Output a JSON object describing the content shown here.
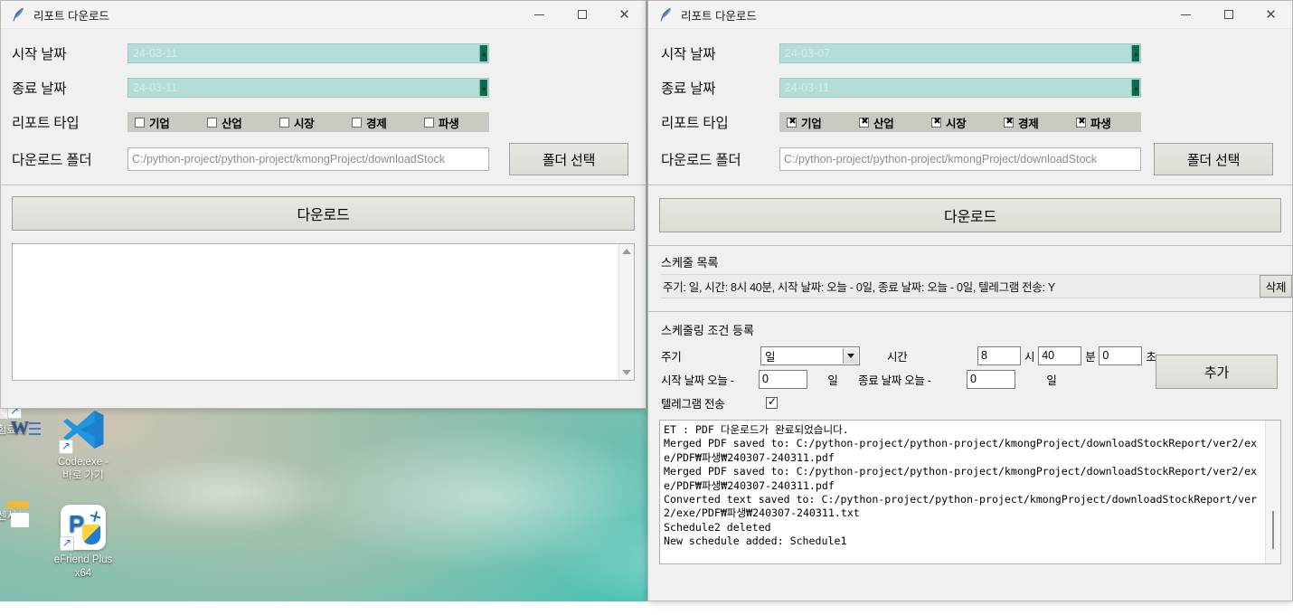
{
  "desktop": {
    "icons": [
      {
        "name": "word-doc-shortcut",
        "label": "보험료…",
        "type": "document"
      },
      {
        "name": "vscode-shortcut",
        "label": "Code.exe -\n바로 가기",
        "type": "vscode"
      },
      {
        "name": "folder-shortcut",
        "label": "견센서…",
        "type": "folder"
      },
      {
        "name": "efriend-plus-shortcut",
        "label": "eFriend Plus\nx64",
        "type": "app"
      }
    ]
  },
  "window_left": {
    "title": "리포트 다운로드",
    "titlebar": {
      "minimize": "–",
      "maximize": "□",
      "close": "✕"
    },
    "form": {
      "start_date_label": "시작 날짜",
      "start_date_value": "24-03-11",
      "end_date_label": "종료 날짜",
      "end_date_value": "24-03-11",
      "report_type_label": "리포트 타입",
      "report_types": [
        {
          "label": "기업",
          "checked": false
        },
        {
          "label": "산업",
          "checked": false
        },
        {
          "label": "시장",
          "checked": false
        },
        {
          "label": "경제",
          "checked": false
        },
        {
          "label": "파생",
          "checked": false
        }
      ],
      "folder_label": "다운로드 폴더",
      "folder_value": "C:/python-project/python-project/kmongProject/downloadStock",
      "folder_button": "폴더 선택"
    },
    "download_button": "다운로드",
    "log_text": ""
  },
  "window_right": {
    "title": "리포트 다운로드",
    "titlebar": {
      "minimize": "–",
      "maximize": "□",
      "close": "✕"
    },
    "form": {
      "start_date_label": "시작 날짜",
      "start_date_value": "24-03-07",
      "end_date_label": "종료 날짜",
      "end_date_value": "24-03-11",
      "report_type_label": "리포트 타입",
      "report_types": [
        {
          "label": "기업",
          "checked": true
        },
        {
          "label": "산업",
          "checked": true
        },
        {
          "label": "시장",
          "checked": true
        },
        {
          "label": "경제",
          "checked": true
        },
        {
          "label": "파생",
          "checked": true
        }
      ],
      "folder_label": "다운로드 폴더",
      "folder_value": "C:/python-project/python-project/kmongProject/downloadStock",
      "folder_button": "폴더 선택"
    },
    "download_button": "다운로드",
    "schedule_list": {
      "section_label": "스케줄 목록",
      "rows": [
        {
          "text": "주기: 일, 시간: 8시 40분, 시작 날짜: 오늘 - 0일, 종료 날짜: 오늘 - 0일, 텔레그램 전송: Y",
          "delete_button": "삭제"
        }
      ]
    },
    "schedule_form": {
      "section_label": "스케줄링 조건 등록",
      "cycle_label": "주기",
      "cycle_value": "일",
      "time_label": "시간",
      "hour_value": "8",
      "hour_unit": "시",
      "minute_value": "40",
      "minute_unit": "분",
      "second_value": "0",
      "second_unit": "초",
      "start_offset_label": "시작 날짜 오늘 -",
      "start_offset_value": "0",
      "start_offset_unit": "일",
      "end_offset_label": "종료 날짜 오늘 -",
      "end_offset_value": "0",
      "end_offset_unit": "일",
      "telegram_label": "텔레그램 전송",
      "telegram_checked": true,
      "add_button": "추가"
    },
    "log_text": "ET : PDF 다운로드가 완료되었습니다.\nMerged PDF saved to: C:/python-project/python-project/kmongProject/downloadStockReport/ver2/exe/PDF₩파생₩240307-240311.pdf\nMerged PDF saved to: C:/python-project/python-project/kmongProject/downloadStockReport/ver2/exe/PDF₩파생₩240307-240311.pdf\nConverted text saved to: C:/python-project/python-project/kmongProject/downloadStockReport/ver2/exe/PDF₩파생₩240307-240311.txt\nSchedule2 deleted\nNew schedule added: Schedule1"
  },
  "colors": {
    "date_field_bg": "#b3ded7",
    "date_button": "#0b6b4f",
    "checkbox_bar": "#c9c9c1",
    "window_bg": "#f0f0f0",
    "button_face": "#e0e0da"
  }
}
